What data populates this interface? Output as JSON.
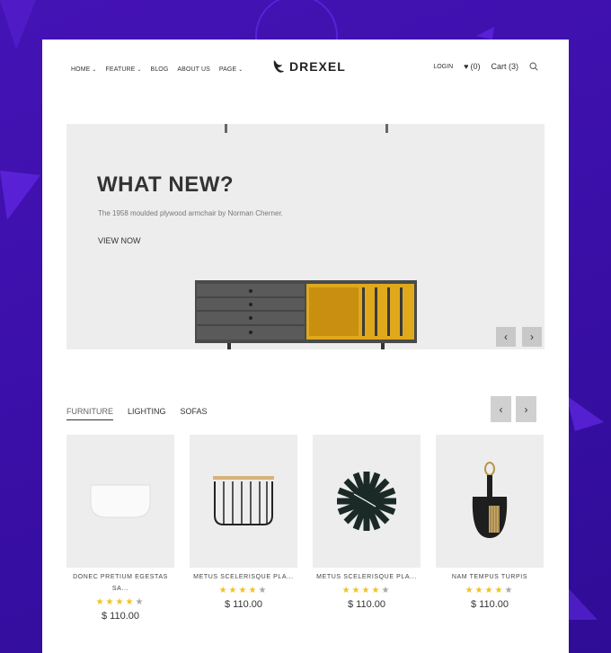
{
  "nav": {
    "items": [
      {
        "label": "HOME",
        "dropdown": true
      },
      {
        "label": "FEATURE",
        "dropdown": true
      },
      {
        "label": "BLOG",
        "dropdown": false
      },
      {
        "label": "ABOUT US",
        "dropdown": false
      },
      {
        "label": "PAGE",
        "dropdown": true
      }
    ]
  },
  "logo": {
    "text": "DREXEL"
  },
  "header": {
    "login": "LOGIN",
    "wishlist": "(0)",
    "cart": "Cart (3)"
  },
  "hero": {
    "title": "WHAT NEW?",
    "subtitle": "The 1958 moulded plywood armchair by Norman Cherner.",
    "cta": "VIEW NOW",
    "prev": "‹",
    "next": "›"
  },
  "tabs": [
    {
      "label": "FURNITURE"
    },
    {
      "label": "LIGHTING"
    },
    {
      "label": "SOFAS"
    }
  ],
  "products_nav": {
    "prev": "‹",
    "next": "›"
  },
  "products": [
    {
      "name": "DONEC PRETIUM EGESTAS SA...",
      "rating": 4,
      "price": "$ 110.00"
    },
    {
      "name": "METUS SCELERISQUE PLA...",
      "rating": 4,
      "price": "$ 110.00"
    },
    {
      "name": "METUS SCELERISQUE PLA...",
      "rating": 4,
      "price": "$ 110.00"
    },
    {
      "name": "NAM TEMPUS TURPIS",
      "rating": 4,
      "price": "$ 110.00"
    }
  ],
  "colors": {
    "background": "#3a0fa8",
    "accent": "#f4c21c",
    "panel": "#ededed"
  }
}
